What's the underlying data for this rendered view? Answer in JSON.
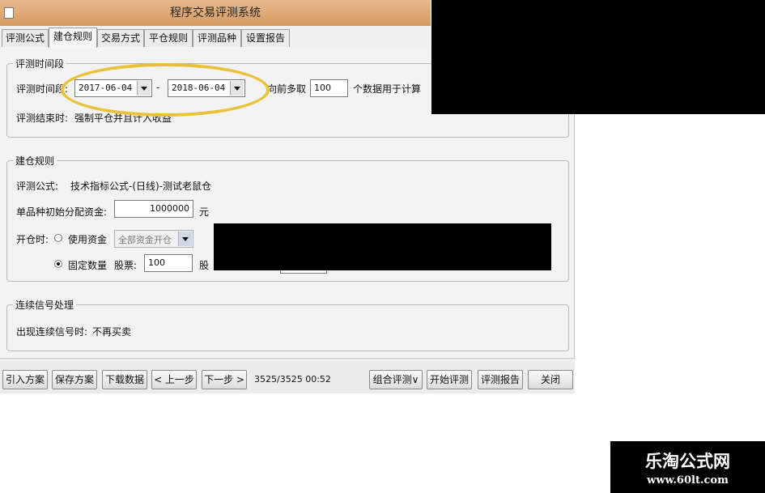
{
  "window": {
    "title": "程序交易评测系统"
  },
  "tabs": [
    {
      "label": "评测公式"
    },
    {
      "label": "建仓规则"
    },
    {
      "label": "交易方式"
    },
    {
      "label": "平仓规则"
    },
    {
      "label": "评测品种"
    },
    {
      "label": "设置报告"
    }
  ],
  "period": {
    "legend": "评测时间段",
    "label": "评测时间段:",
    "start": "2017-06-04",
    "end": "2018-06-04",
    "dash": "-",
    "forward_label": "向前多取",
    "forward_value": "100",
    "forward_suffix": "个数据用于计算",
    "end_rule_label": "评测结束时:",
    "end_rule_value": "强制平仓并且计入收益"
  },
  "build": {
    "legend": "建仓规则",
    "formula_label": "评测公式:",
    "formula_value": "技术指标公式-(日线)-测试老鼠仓",
    "capital_label": "单品种初始分配资金:",
    "capital_value": "1000000",
    "capital_unit": "元",
    "open_label": "开仓时:",
    "use_funds_label": "使用资金",
    "use_funds_option": "全部资金开仓",
    "fixed_label": "固定数量",
    "shares_label": "股票:",
    "shares_value": "100",
    "shares_unit": "股"
  },
  "signal": {
    "legend": "连续信号处理",
    "label": "出现连续信号时:",
    "value": "不再买卖"
  },
  "bottom": {
    "import": "引入方案",
    "save": "保存方案",
    "download": "下载数据",
    "prev": "< 上一步",
    "next": "下一步 >",
    "status": "3525/3525 00:52",
    "combo": "组合评测∨",
    "start": "开始评测",
    "report": "评测报告",
    "close": "关闭"
  },
  "watermark": {
    "name": "乐淘公式网",
    "url": "www.60lt.com"
  },
  "colors": {
    "title_bar": "#d9a26d",
    "highlight": "#e8c23a"
  }
}
